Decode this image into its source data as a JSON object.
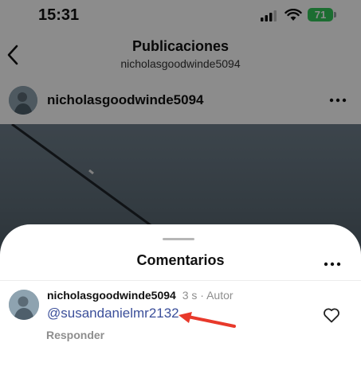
{
  "status_bar": {
    "time": "15:31",
    "battery": "71",
    "battery_color": "#33c759",
    "icons": [
      "signal-icon",
      "wifi-icon",
      "battery-icon"
    ]
  },
  "header": {
    "back_icon": "chevron-left-icon",
    "title": "Publicaciones",
    "subtitle": "nicholasgoodwinde5094"
  },
  "post": {
    "username": "nicholasgoodwinde5094",
    "more_icon": "more-horizontal-icon"
  },
  "comments_sheet": {
    "title": "Comentarios",
    "more_icon": "more-horizontal-icon",
    "comments": [
      {
        "username": "nicholasgoodwinde5094",
        "time": "3 s",
        "separator": "·",
        "badge": "Autor",
        "text": "@susandanielmr2132",
        "reply_label": "Responder",
        "like_icon": "heart-icon"
      }
    ]
  },
  "colors": {
    "mention": "#3b4f9a",
    "annotation_arrow": "#e8392b"
  }
}
